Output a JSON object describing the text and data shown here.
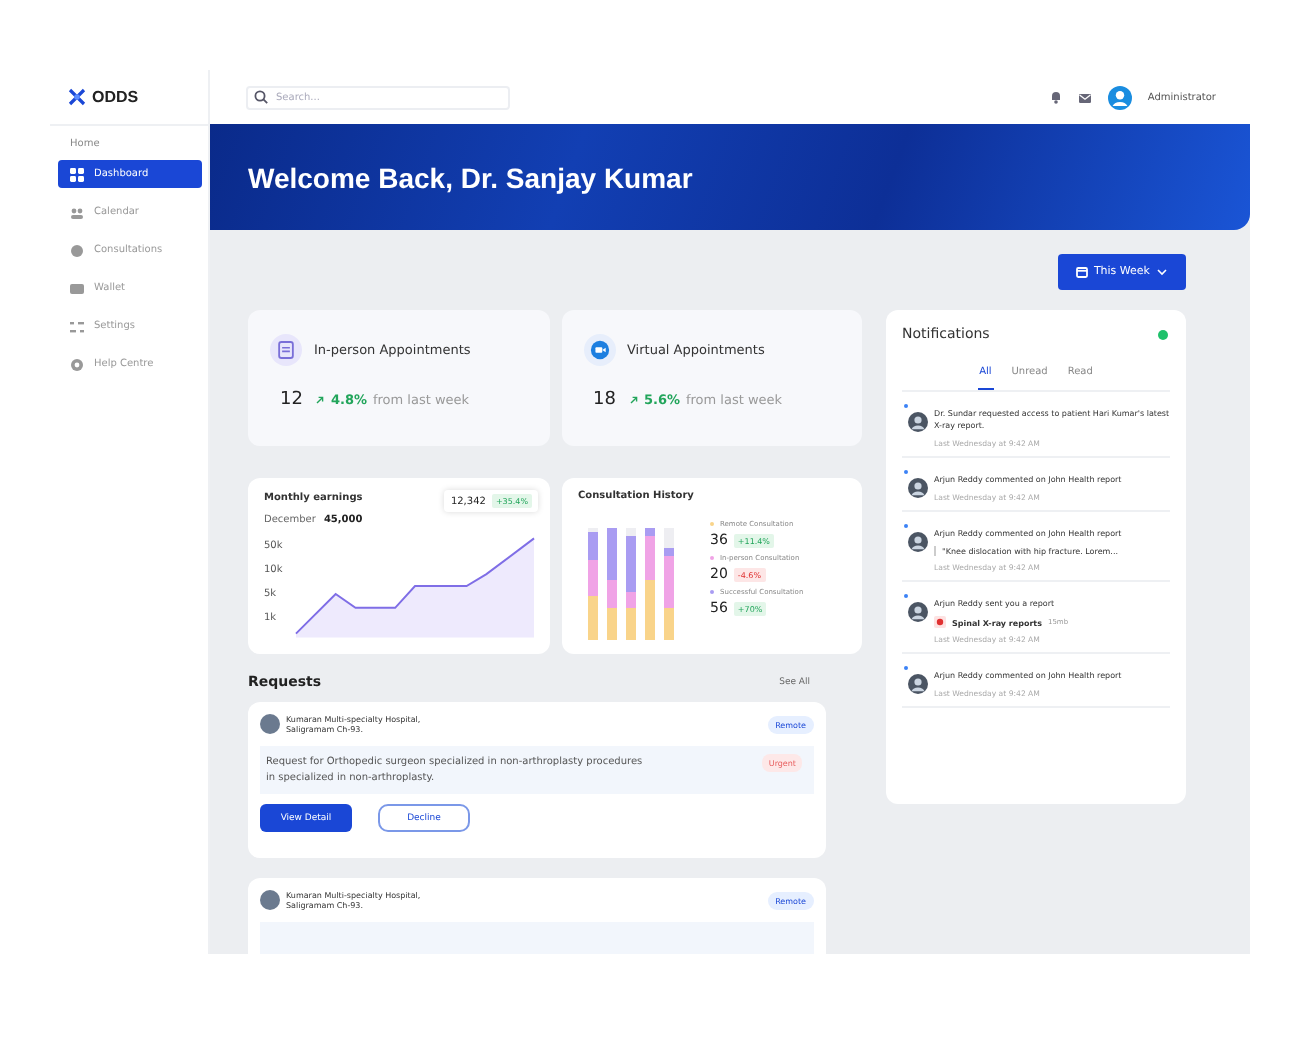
{
  "brand": {
    "name": "ODDS"
  },
  "search": {
    "placeholder": "Search..."
  },
  "user": {
    "name": "Administrator"
  },
  "sidebar": {
    "section": "Home",
    "items": [
      {
        "label": "Dashboard",
        "selected": true
      },
      {
        "label": "Calendar",
        "selected": false
      },
      {
        "label": "Consultations",
        "selected": false
      },
      {
        "label": "Wallet",
        "selected": false
      },
      {
        "label": "Settings",
        "selected": false
      },
      {
        "label": "Help Centre",
        "selected": false
      }
    ]
  },
  "banner": {
    "title": "Welcome Back, Dr. Sanjay Kumar"
  },
  "period_button": {
    "label": "This Week"
  },
  "stats": [
    {
      "title": "In-person Appointments",
      "count": "12",
      "change": "4.8%",
      "suffix": "from last week"
    },
    {
      "title": "Virtual Appointments",
      "count": "18",
      "change": "5.6%",
      "suffix": "from last week"
    }
  ],
  "earnings": {
    "title": "Monthly earnings",
    "month": "December",
    "amount": "45,000",
    "tooltip_value": "12,342",
    "tooltip_change": "+35.4%",
    "y_labels": [
      "50k",
      "10k",
      "5k",
      "1k"
    ]
  },
  "consultation_history": {
    "title": "Consultation History",
    "legend": [
      {
        "label": "Remote Consultation",
        "value": "36",
        "change": "+11.4%",
        "kind": "up",
        "color": "#f9d48a"
      },
      {
        "label": "In-person Consultation",
        "value": "20",
        "change": "-4.6%",
        "kind": "down",
        "color": "#f0a3e6"
      },
      {
        "label": "Successful Consultation",
        "value": "56",
        "change": "+70%",
        "kind": "up",
        "color": "#a99cf2"
      }
    ]
  },
  "requests": {
    "title": "Requests",
    "see_all": "See All",
    "items": [
      {
        "hospital": "Kumaran Multi-specialty Hospital, Saligramam Ch-93.",
        "tag": "Remote",
        "message": "Request for Orthopedic surgeon specialized in non-arthroplasty procedures in  specialized in non-arthroplasty.",
        "priority": "Urgent",
        "primary": "View Detail",
        "secondary": "Decline"
      },
      {
        "hospital": "Kumaran Multi-specialty Hospital, Saligramam Ch-93.",
        "tag": "Remote"
      }
    ]
  },
  "notifications": {
    "title": "Notifications",
    "online": true,
    "tabs": [
      {
        "label": "All",
        "selected": true
      },
      {
        "label": "Unread",
        "selected": false
      },
      {
        "label": "Read",
        "selected": false
      }
    ],
    "items": [
      {
        "text": "Dr. Sundar requested access to patient Hari Kumar's latest X-ray report.",
        "time": "Last Wednesday at 9:42 AM",
        "unread": true
      },
      {
        "text": "Arjun Reddy commented on John Health report",
        "time": "Last Wednesday at 9:42 AM",
        "unread": true
      },
      {
        "text": "Arjun Reddy commented on John Health report",
        "quote": "\"Knee dislocation with hip fracture. Lorem...",
        "time": "Last Wednesday at 9:42 AM",
        "unread": true
      },
      {
        "text": "Arjun Reddy sent you a report",
        "attachment": {
          "name": "Spinal X-ray reports",
          "size": "15mb"
        },
        "time": "Last Wednesday at 9:42 AM",
        "unread": true
      },
      {
        "text": "Arjun Reddy commented on John Health report",
        "time": "Last Wednesday at 9:42 AM",
        "unread": true
      }
    ]
  }
}
